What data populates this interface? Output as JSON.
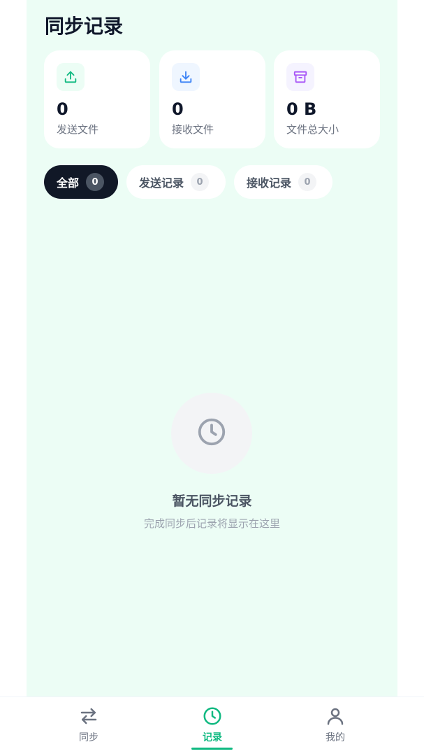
{
  "header": {
    "title": "同步记录"
  },
  "stats": [
    {
      "value": "0",
      "label": "发送文件",
      "icon": "upload-icon",
      "icon_color": "#10b981",
      "icon_bg": "#ecfdf5"
    },
    {
      "value": "0",
      "label": "接收文件",
      "icon": "download-icon",
      "icon_color": "#3b82f6",
      "icon_bg": "#eff6ff"
    },
    {
      "value": "0 B",
      "label": "文件总大小",
      "icon": "archive-icon",
      "icon_color": "#a855f7",
      "icon_bg": "#f5f3ff"
    }
  ],
  "filters": [
    {
      "label": "全部",
      "count": "0",
      "active": true
    },
    {
      "label": "发送记录",
      "count": "0",
      "active": false
    },
    {
      "label": "接收记录",
      "count": "0",
      "active": false
    }
  ],
  "empty_state": {
    "title": "暂无同步记录",
    "subtitle": "完成同步后记录将显示在这里",
    "icon": "clock-icon"
  },
  "tabbar": {
    "items": [
      {
        "label": "同步",
        "icon": "swap-arrows-icon",
        "active": false
      },
      {
        "label": "记录",
        "icon": "clock-icon",
        "active": true
      },
      {
        "label": "我的",
        "icon": "user-icon",
        "active": false
      }
    ]
  },
  "colors": {
    "accent": "#10b981",
    "background": "#ecfdf5",
    "dark_chip": "#111827"
  }
}
